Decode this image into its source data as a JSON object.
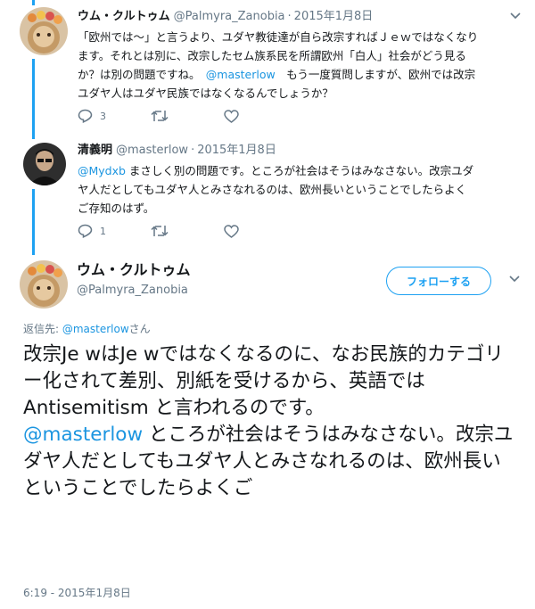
{
  "tweets": [
    {
      "name": "ウム・クルトゥム",
      "handle": "@Palmyra_Zanobia",
      "date": "2015年1月8日",
      "text_lines": [
        "「欧州では〜」と言うより、ユダヤ教徒達が自ら改宗すればＪｅｗではなくなり",
        "ます。それとは別に、改宗したセム族系民を所謂欧州「白人」社会がどう見る"
      ],
      "line3_before": "か？は別の問題ですね。　",
      "line3_mention": "@masterlow",
      "line3_after": "　もう一度質問しますが、欧州では改宗",
      "line4": "ユダヤ人はユダヤ民族ではなくなるんでしょうか？",
      "reply_count": "3",
      "retweet_count": "",
      "like_count": ""
    },
    {
      "name": "清義明",
      "handle": "@masterlow",
      "date": "2015年1月8日",
      "mention": "@Mydxb",
      "line1_after": " まさしく別の問題です。ところが社会はそうはみなさない。改宗ユダ",
      "line2": "ヤ人だとしてもユダヤ人とみさなれるのは、欧州長いということでしたらよく",
      "line3": "ご存知のはず。",
      "reply_count": "1",
      "retweet_count": "",
      "like_count": ""
    }
  ],
  "main": {
    "name": "ウム・クルトゥム",
    "handle": "@Palmyra_Zanobia",
    "follow_label": "フォローする",
    "reply_prefix": "返信先: ",
    "reply_mention": "@masterlow",
    "reply_suffix": "さん",
    "para1": "改宗Je wはJe wではなくなるのに、なお民族的カテゴリー化されて差別、別紙を受けるから、英語ではAntisemitism と言われるのです。",
    "mention": "@masterlow",
    "para2": " ところが社会はそうはみなさない。改宗ユダヤ人だとしてもユダヤ人とみさなれるのは、欧州長いということでしたらよくご",
    "timestamp": "6:19 - 2015年1月8日"
  },
  "colors": {
    "accent": "#1da1f2",
    "link": "#1b95e0",
    "muted": "#657786",
    "text": "#14171a"
  },
  "icons": [
    "reply-icon",
    "retweet-icon",
    "like-icon",
    "chevron-down-icon"
  ]
}
